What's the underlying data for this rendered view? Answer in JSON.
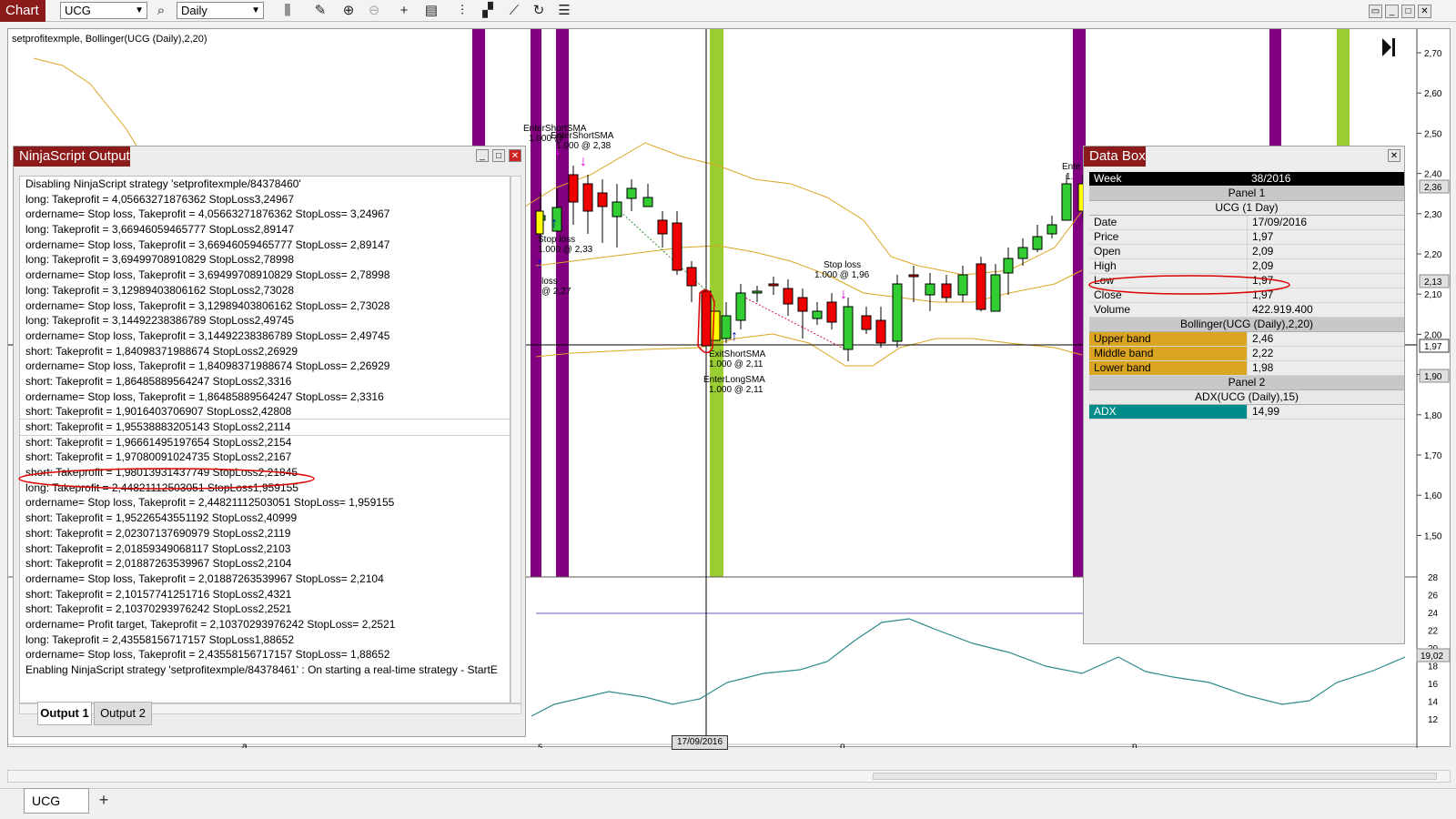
{
  "toolbar": {
    "chart_label": "Chart",
    "instrument": "UCG",
    "interval": "Daily"
  },
  "chart": {
    "title": "setprofitexmple, Bollinger(UCG (Daily),2,20)",
    "price_ticks": [
      "2,70",
      "2,60",
      "2,50",
      "2,40",
      "2,30",
      "2,20",
      "2,10",
      "2,00",
      "1,90",
      "1,80",
      "1,70",
      "1,60",
      "1,50"
    ],
    "adx_ticks": [
      "28",
      "26",
      "24",
      "22",
      "20",
      "18",
      "16",
      "14",
      "12"
    ],
    "price_flags": [
      "2,36",
      "2,13",
      "1,97",
      "1,90"
    ],
    "adx_flag": "19,02",
    "x_labels": [
      "a",
      "s",
      "o",
      "n"
    ],
    "crosshair_date": "17/09/2016",
    "annotations": {
      "enter_short_1": "EnterShortSMA",
      "enter_short_1_val": "1.000 @",
      "enter_short_2": "EnterShortSMA",
      "enter_short_2_val": "1.000 @ 2,38",
      "stop_loss_left": "Stop loss",
      "stop_loss_left_val": "1.000 @ 2,33",
      "loss_left": "loss",
      "loss_left_val": "@ 2,27",
      "exit_short": "ExitShortSMA",
      "exit_short_val": "1.000 @ 2,11",
      "enter_long": "EnterLongSMA",
      "enter_long_val": "1.000 @ 2,11",
      "stop_loss_mid": "Stop loss",
      "stop_loss_mid_val": "1.000 @ 1,96",
      "enter_right": "Ente",
      "enter_right_val": "1."
    }
  },
  "ninjascript": {
    "title": "NinjaScript Output",
    "lines": [
      "Disabling NinjaScript strategy 'setprofitexmple/84378460'",
      "long: Takeprofit = 4,05663271876362 StopLoss3,24967",
      "ordername= Stop loss, Takeprofit = 4,05663271876362 StopLoss= 3,24967",
      "long: Takeprofit = 3,66946059465777 StopLoss2,89147",
      "ordername= Stop loss, Takeprofit = 3,66946059465777 StopLoss= 2,89147",
      "long: Takeprofit = 3,69499708910829 StopLoss2,78998",
      "ordername= Stop loss, Takeprofit = 3,69499708910829 StopLoss= 2,78998",
      "long: Takeprofit = 3,12989403806162 StopLoss2,73028",
      "ordername= Stop loss, Takeprofit = 3,12989403806162 StopLoss= 2,73028",
      "long: Takeprofit = 3,14492238386789 StopLoss2,49745",
      "ordername= Stop loss, Takeprofit = 3,14492238386789 StopLoss= 2,49745",
      "short: Takeprofit = 1,84098371988674 StopLoss2,26929",
      "ordername= Stop loss, Takeprofit = 1,84098371988674 StopLoss= 2,26929",
      "short: Takeprofit = 1,86485889564247 StopLoss2,3316",
      "ordername= Stop loss, Takeprofit = 1,86485889564247 StopLoss= 2,3316",
      "short: Takeprofit = 1,9016403706907 StopLoss2,42808",
      "short: Takeprofit = 1,95538883205143 StopLoss2,2114",
      "short: Takeprofit = 1,96661495197654 StopLoss2,2154",
      "short: Takeprofit = 1,97080091024735 StopLoss2,2167",
      "short: Takeprofit = 1,98013931437749 StopLoss2,21845",
      "long: Takeprofit = 2,44821112503051 StopLoss1,959155",
      "ordername= Stop loss, Takeprofit = 2,44821112503051 StopLoss= 1,959155",
      "short: Takeprofit = 1,95226543551192 StopLoss2,40999",
      "short: Takeprofit = 2,02307137690979 StopLoss2,2119",
      "short: Takeprofit = 2,01859349068117 StopLoss2,2103",
      "short: Takeprofit = 2,01887263539967 StopLoss2,2104",
      "ordername= Stop loss, Takeprofit = 2,01887263539967 StopLoss= 2,2104",
      "short: Takeprofit = 2,10157741251716 StopLoss2,4321",
      "short: Takeprofit = 2,10370293976242 StopLoss2,2521",
      "ordername= Profit target, Takeprofit = 2,10370293976242 StopLoss= 2,2521",
      "long: Takeprofit = 2,43558156717157 StopLoss1,88652",
      "ordername= Stop loss, Takeprofit = 2,43558156717157 StopLoss= 1,88652",
      "Enabling NinjaScript strategy 'setprofitexmple/84378461' : On starting a real-time strategy - StartE"
    ],
    "tabs": [
      "Output 1",
      "Output 2"
    ]
  },
  "databox": {
    "title": "Data Box",
    "week_label": "Week",
    "week_value": "38/2016",
    "panel1": "Panel 1",
    "instrument": "UCG (1 Day)",
    "rows": [
      {
        "label": "Date",
        "value": "17/09/2016"
      },
      {
        "label": "Price",
        "value": "1,97"
      },
      {
        "label": "Open",
        "value": "2,09"
      },
      {
        "label": "High",
        "value": "2,09"
      },
      {
        "label": "Low",
        "value": "1,97"
      },
      {
        "label": "Close",
        "value": "1,97"
      },
      {
        "label": "Volume",
        "value": "422.919.400"
      }
    ],
    "bollinger": "Bollinger(UCG (Daily),2,20)",
    "bands": [
      {
        "label": "Upper band",
        "value": "2,46"
      },
      {
        "label": "Middle band",
        "value": "2,22"
      },
      {
        "label": "Lower band",
        "value": "1,98"
      }
    ],
    "panel2": "Panel 2",
    "adx_title": "ADX(UCG (Daily),15)",
    "adx_label": "ADX",
    "adx_value": "14,99"
  },
  "bottom": {
    "tab_label": "UCG",
    "add_label": "+"
  },
  "colors": {
    "accent": "#8b1a1a",
    "purple_bar": "#800080",
    "green_bar": "#9acd32",
    "band": "#daa520",
    "adx_line": "#2e8b8b",
    "up_candle": "#32cd32",
    "down_candle": "#ee0000",
    "band_highlight": "#daa520",
    "adx_highlight": "#008b8b"
  }
}
